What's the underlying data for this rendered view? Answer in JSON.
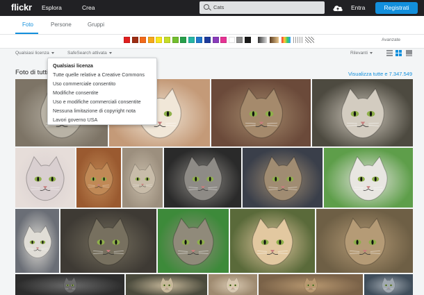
{
  "topbar": {
    "logo": "flickr",
    "nav": [
      "Esplora",
      "Crea"
    ],
    "search_value": "Cats",
    "login": "Entra",
    "register": "Registrati"
  },
  "tabs": [
    "Foto",
    "Persone",
    "Gruppi"
  ],
  "color_filters": [
    "#e11f1f",
    "#9e2e14",
    "#f26a1b",
    "#f7a81b",
    "#f9e71e",
    "#c6dd27",
    "#73bf2e",
    "#27a04b",
    "#27b5a5",
    "#2277cc",
    "#1d3b9c",
    "#8a3dbb",
    "#e63394",
    "#ffffff",
    "#8c8c8c",
    "#1a1a1a"
  ],
  "pattern_filters": [
    "greyscale-pattern",
    "sepia-pattern",
    "colorful-pattern",
    "lines-pattern",
    "stripes-pattern"
  ],
  "advanced": "Avanzate",
  "filters": {
    "license": "Qualsiasi licenza",
    "safesearch": "SafeSearch attivata",
    "sort": "Rilevanti"
  },
  "license_menu": [
    "Qualsiasi licenza",
    "Tutte quelle relative a Creative Commons",
    "Uso commerciale consentito",
    "Modifiche consentite",
    "Uso e modifiche commerciali consentite",
    "Nessuna limitazione di copyright nota",
    "Lavori governo USA"
  ],
  "results": {
    "heading": "Foto di tutti",
    "see_all": "Visualizza tutte e 7.347.549"
  },
  "photos": [
    {
      "bg": "#7d7466",
      "fur": "#b9b3a6"
    },
    {
      "bg": "#c49a78",
      "fur": "#f1e7d8"
    },
    {
      "bg": "#6b4a3a",
      "fur": "#a58a6c"
    },
    {
      "bg": "#4d4a40",
      "fur": "#d3ccc0"
    },
    {
      "bg": "#e6ddd9",
      "fur": "#d9cfd0"
    },
    {
      "bg": "#9a5a30",
      "fur": "#c08956"
    },
    {
      "bg": "#9c8f7e",
      "fur": "#c8bca9"
    },
    {
      "bg": "#2a2a2a",
      "fur": "#8e8b86"
    },
    {
      "bg": "#3a3f4a",
      "fur": "#a08c72"
    },
    {
      "bg": "#5e9e4a",
      "fur": "#e8e6e1"
    },
    {
      "bg": "#6a6e76",
      "fur": "#e0ddd6"
    },
    {
      "bg": "#3e3a34",
      "fur": "#77705f"
    },
    {
      "bg": "#3d8a3a",
      "fur": "#908a7a"
    },
    {
      "bg": "#5a6a3a",
      "fur": "#e2c8a0"
    },
    {
      "bg": "#6e5f45",
      "fur": "#b59b76"
    },
    {
      "bg": "#2c2c2c",
      "fur": "#6a6a6a"
    },
    {
      "bg": "#4a4a3c",
      "fur": "#c7b89a"
    },
    {
      "bg": "#9e8a70",
      "fur": "#d8c8b0"
    },
    {
      "bg": "#7a6248",
      "fur": "#b89870"
    },
    {
      "bg": "#3f4d5a",
      "fur": "#a0a8b0"
    }
  ]
}
